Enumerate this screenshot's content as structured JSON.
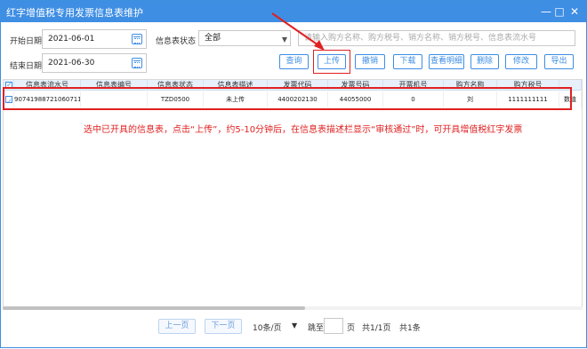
{
  "window": {
    "title": "红字增值税专用发票信息表维护",
    "controls": [
      "—",
      "□",
      "✕"
    ]
  },
  "filters": {
    "start_date_label": "开始日期",
    "start_date_value": "2021-06-01",
    "end_date_label": "结束日期",
    "end_date_value": "2021-06-30",
    "status_label": "信息表状态",
    "status_value": "全部",
    "keyword_placeholder": "请输入购方名称、购方税号、销方名称、销方税号、信息表流水号"
  },
  "toolbar": {
    "query": "查询",
    "upload": "上传",
    "revoke": "撤销",
    "download": "下载",
    "view_detail": "查看明细",
    "delete": "删除",
    "modify": "修改",
    "export": "导出"
  },
  "table": {
    "columns": [
      "信息表流水号",
      "信息表编号",
      "信息表状态",
      "信息表描述",
      "发票代码",
      "发票号码",
      "开票机号",
      "购方名称",
      "购方税号",
      ""
    ],
    "rows": [
      {
        "checked": true,
        "cells": [
          "90741988721060711",
          "",
          "TZD0500",
          "未上传",
          "4400202130",
          "44055000",
          "0",
          "刘",
          "1111111111",
          "数值"
        ]
      }
    ]
  },
  "annotation": "选中已开具的信息表，点击“上传”，约5-10分钟后，在信息表描述栏显示“审核通过”时，可开具增值税红字发票",
  "pagination": {
    "prev": "上一页",
    "next": "下一页",
    "page_size": "10条/页",
    "goto_label": "跳至",
    "page_unit": "页",
    "page_info": "共1/1页",
    "total": "共1条"
  },
  "colors": {
    "accent": "#3e8ee4",
    "highlight": "#e02020"
  }
}
